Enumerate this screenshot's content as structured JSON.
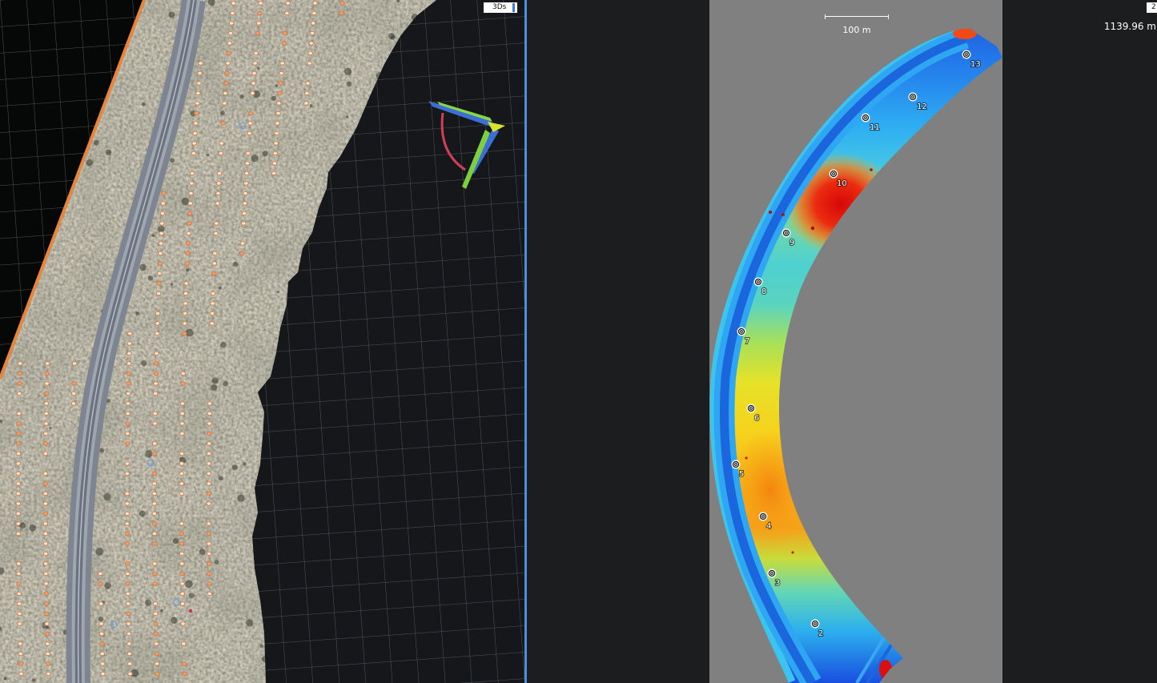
{
  "left_view": {
    "view_toggle_label": "3Ds"
  },
  "right_view": {
    "view_toggle_label": "2",
    "scale_bar_label": "100 m",
    "elevation_readout": "1139.96 m",
    "gcps": [
      {
        "label": "2"
      },
      {
        "label": "3"
      },
      {
        "label": "4"
      },
      {
        "label": "5"
      },
      {
        "label": "6"
      },
      {
        "label": "7"
      },
      {
        "label": "8"
      },
      {
        "label": "9"
      },
      {
        "label": "10"
      },
      {
        "label": "11"
      },
      {
        "label": "12"
      },
      {
        "label": "13"
      }
    ]
  },
  "colors": {
    "project_boundary": "#e8853a",
    "viewport_divider": "#4a90e2",
    "dsm_background": "#808080",
    "elevation_low": "#1a4ee0",
    "elevation_high": "#d40808"
  },
  "icons": {
    "axis_gizmo": "axis-gizmo-icon",
    "gcp_marker": "gcp-target-icon",
    "ground_target": "ground-target-icon"
  }
}
